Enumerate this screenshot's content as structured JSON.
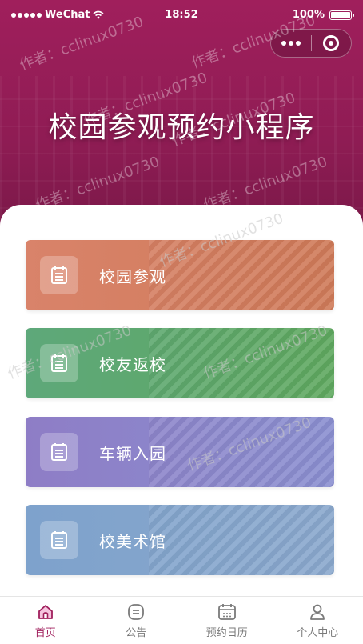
{
  "status_bar": {
    "carrier": "WeChat",
    "time": "18:52",
    "battery": "100%"
  },
  "header": {
    "title": "校园参观预约小程序"
  },
  "menu": [
    {
      "label": "校园参观",
      "color_start": "#d9836a",
      "color_end": "#cf7a58",
      "icon": "calendar-icon"
    },
    {
      "label": "校友返校",
      "color_start": "#5ea87a",
      "color_end": "#5fa85f",
      "icon": "calendar-icon"
    },
    {
      "label": "车辆入园",
      "color_start": "#8e7dc6",
      "color_end": "#8a8fd0",
      "icon": "calendar-icon"
    },
    {
      "label": "校美术馆",
      "color_start": "#7ea2cc",
      "color_end": "#8aa8cd",
      "icon": "calendar-icon"
    }
  ],
  "tabbar": [
    {
      "label": "首页",
      "icon": "home-icon",
      "active": true
    },
    {
      "label": "公告",
      "icon": "notice-icon",
      "active": false
    },
    {
      "label": "预约日历",
      "icon": "calendar-icon",
      "active": false
    },
    {
      "label": "个人中心",
      "icon": "user-icon",
      "active": false
    }
  ],
  "watermark": "作者：cclinux0730",
  "colors": {
    "brand": "#a01f5c",
    "tab_inactive": "#7a7a7a"
  }
}
